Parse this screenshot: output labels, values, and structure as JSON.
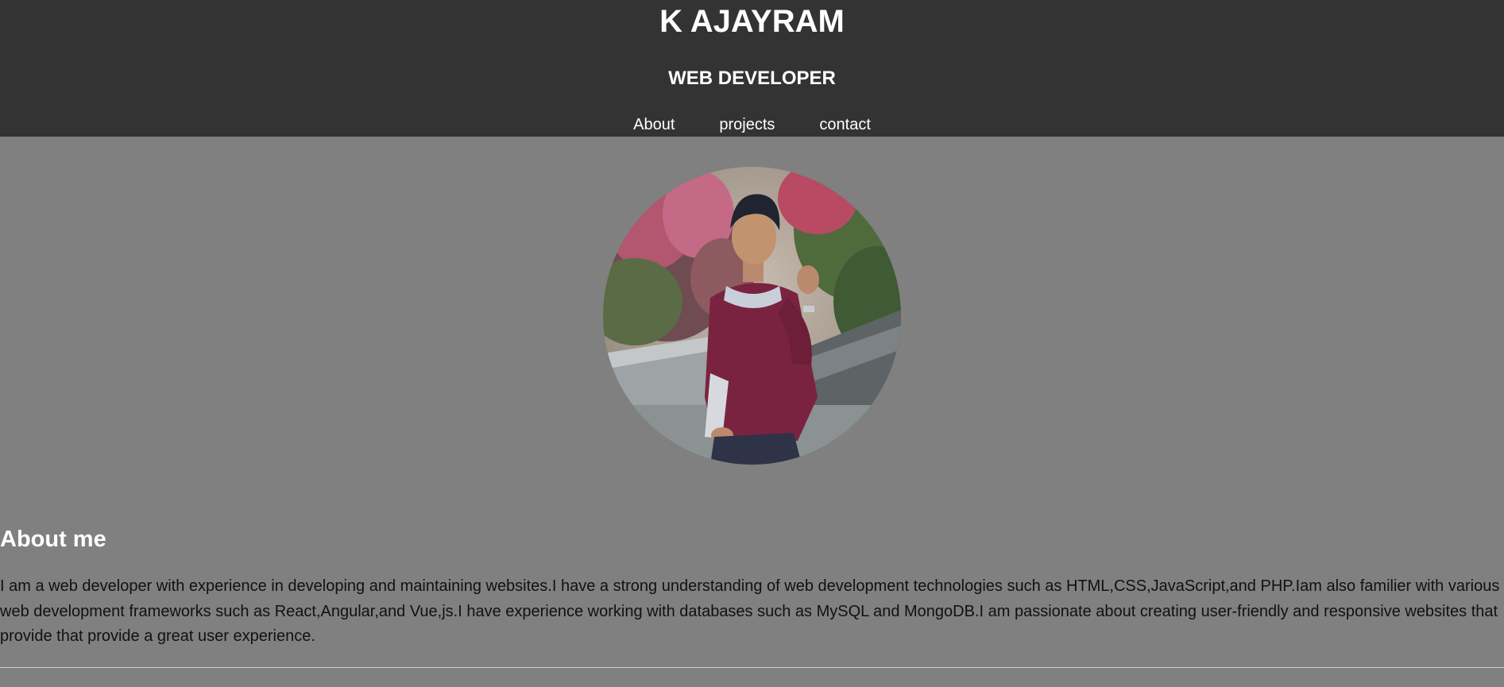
{
  "header": {
    "title": "K AJAYRAM",
    "subtitle": "WEB DEVELOPER",
    "background": "#333333"
  },
  "nav": {
    "items": [
      {
        "label": "About"
      },
      {
        "label": "projects"
      },
      {
        "label": "contact"
      }
    ]
  },
  "profile": {
    "photo_icon": "profile-photo"
  },
  "about": {
    "heading": "About me",
    "paragraph": "I am a web developer with experience in developing and maintaining websites.I have a strong understanding of web development technologies such as HTML,CSS,JavaScript,and PHP.Iam also familier with various web development frameworks such as React,Angular,and Vue,js.I have experience working with databases such as MySQL and MongoDB.I am passionate about creating user-friendly and responsive websites that provide that provide a great user experience."
  },
  "colors": {
    "page_background": "#808080",
    "header_background": "#333333",
    "heading_text": "#ffffff",
    "body_text": "#111111"
  }
}
